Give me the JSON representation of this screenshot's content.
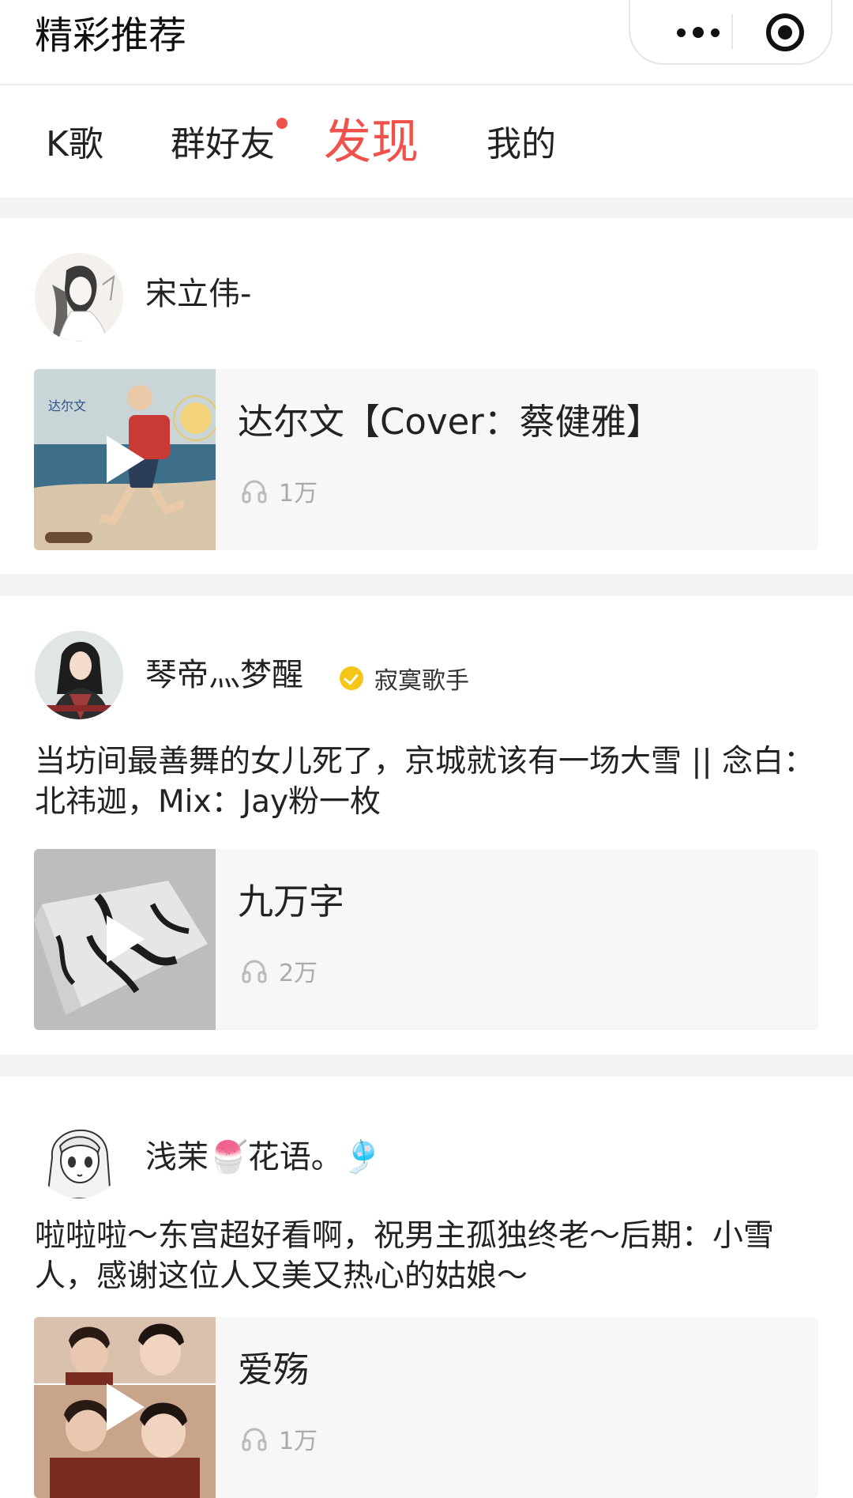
{
  "header": {
    "title": "精彩推荐",
    "more_icon": "more-dots-icon",
    "close_icon": "target-circle-icon"
  },
  "tabs": [
    {
      "label": "K歌",
      "active": false
    },
    {
      "label": "群好友",
      "active": false,
      "badge": "red-dot"
    },
    {
      "label": "发现",
      "active": true
    },
    {
      "label": "我的",
      "active": false
    }
  ],
  "accent_color": "#f0524b",
  "posts": [
    {
      "user": "宋立伟-",
      "avatar": "ink-drawing-avatar",
      "description": "",
      "song": {
        "title": "达尔文【Cover：蔡健雅】",
        "plays": "1万",
        "cover": "runner-illustration-cover"
      }
    },
    {
      "user": "琴帝灬梦醒",
      "badge": "寂寞歌手",
      "avatar": "warrior-illustration-avatar",
      "description": "当坊间最善舞的女儿死了，京城就该有一场大雪 || 念白：北祎迦，Mix：Jay粉一枚",
      "song": {
        "title": "九万字",
        "plays": "2万",
        "cover": "calligraphy-paper-cover"
      }
    },
    {
      "user": "浅茉🍧花语。🎐",
      "avatar": "anime-girl-avatar",
      "description": "啦啦啦～东宫超好看啊，祝男主孤独终老～后期：小雪人，感谢这位人又美又热心的姑娘～",
      "song": {
        "title": "爱殇",
        "plays": "1万",
        "cover": "drama-stills-cover"
      }
    }
  ]
}
